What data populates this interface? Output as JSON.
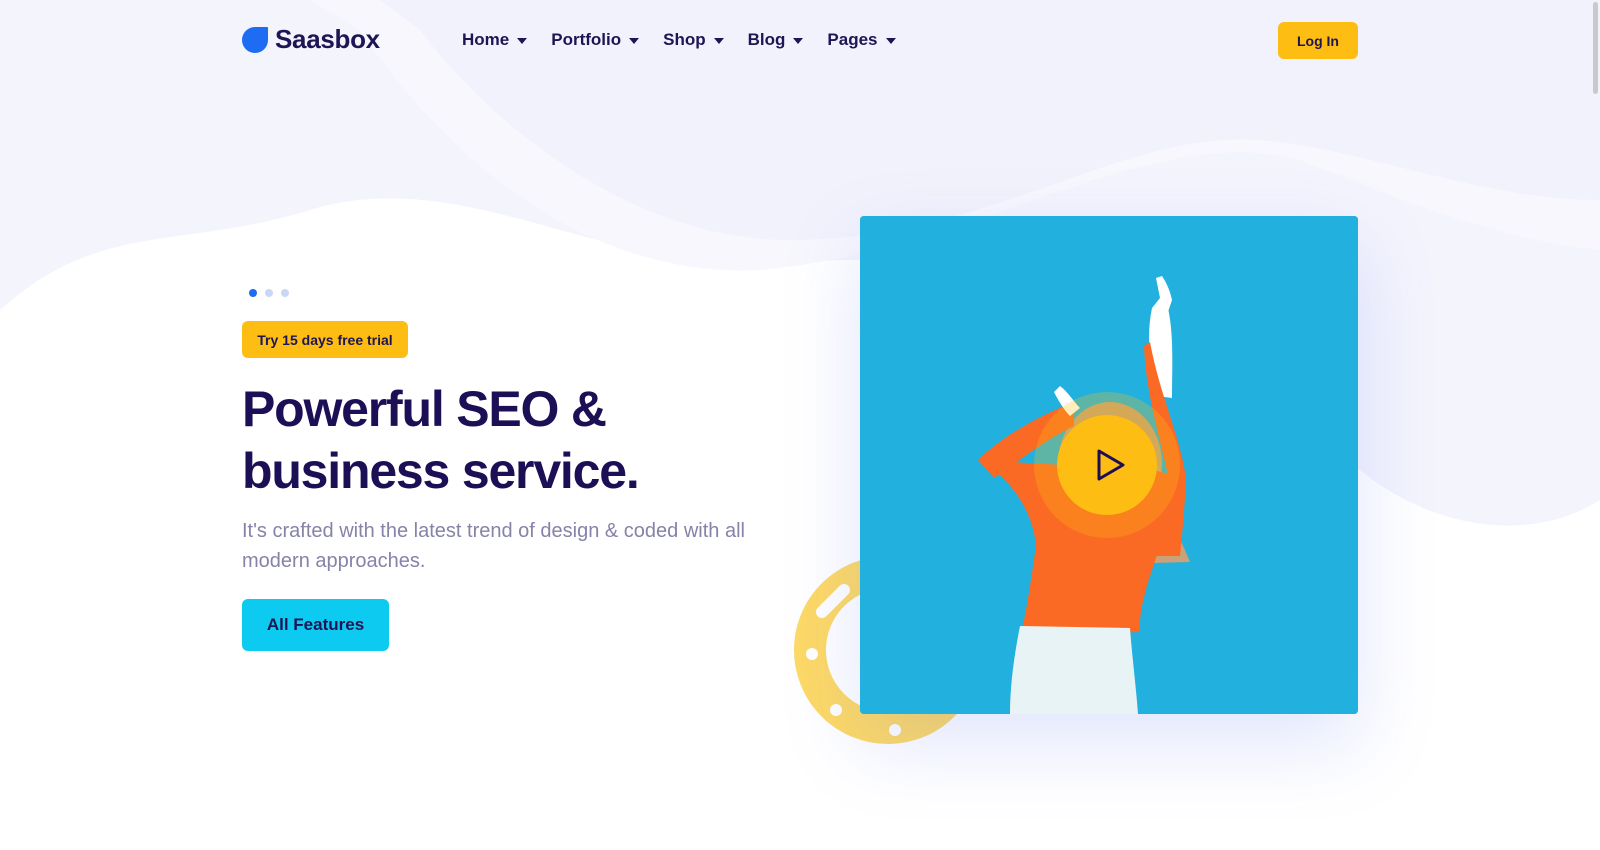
{
  "brand": {
    "name": "Saasbox"
  },
  "nav": {
    "items": [
      {
        "label": "Home"
      },
      {
        "label": "Portfolio"
      },
      {
        "label": "Shop"
      },
      {
        "label": "Blog"
      },
      {
        "label": "Pages"
      }
    ]
  },
  "header": {
    "login_label": "Log In"
  },
  "hero": {
    "slider_dots": 3,
    "active_dot": 1,
    "badge": "Try 15 days free trial",
    "title_line1": "Powerful SEO &",
    "title_line2": "business service.",
    "subtitle": "It's crafted with the latest trend of design & coded with all modern approaches.",
    "cta_label": "All Features"
  },
  "media": {
    "play_icon": "play-icon"
  },
  "colors": {
    "primary_dark": "#1d0f55",
    "accent_yellow": "#fdbd12",
    "cta_cyan": "#0dcaf0",
    "brand_blue": "#1e6cf2",
    "media_bg": "#22b0de",
    "subtitle_gray": "#8583a8"
  }
}
